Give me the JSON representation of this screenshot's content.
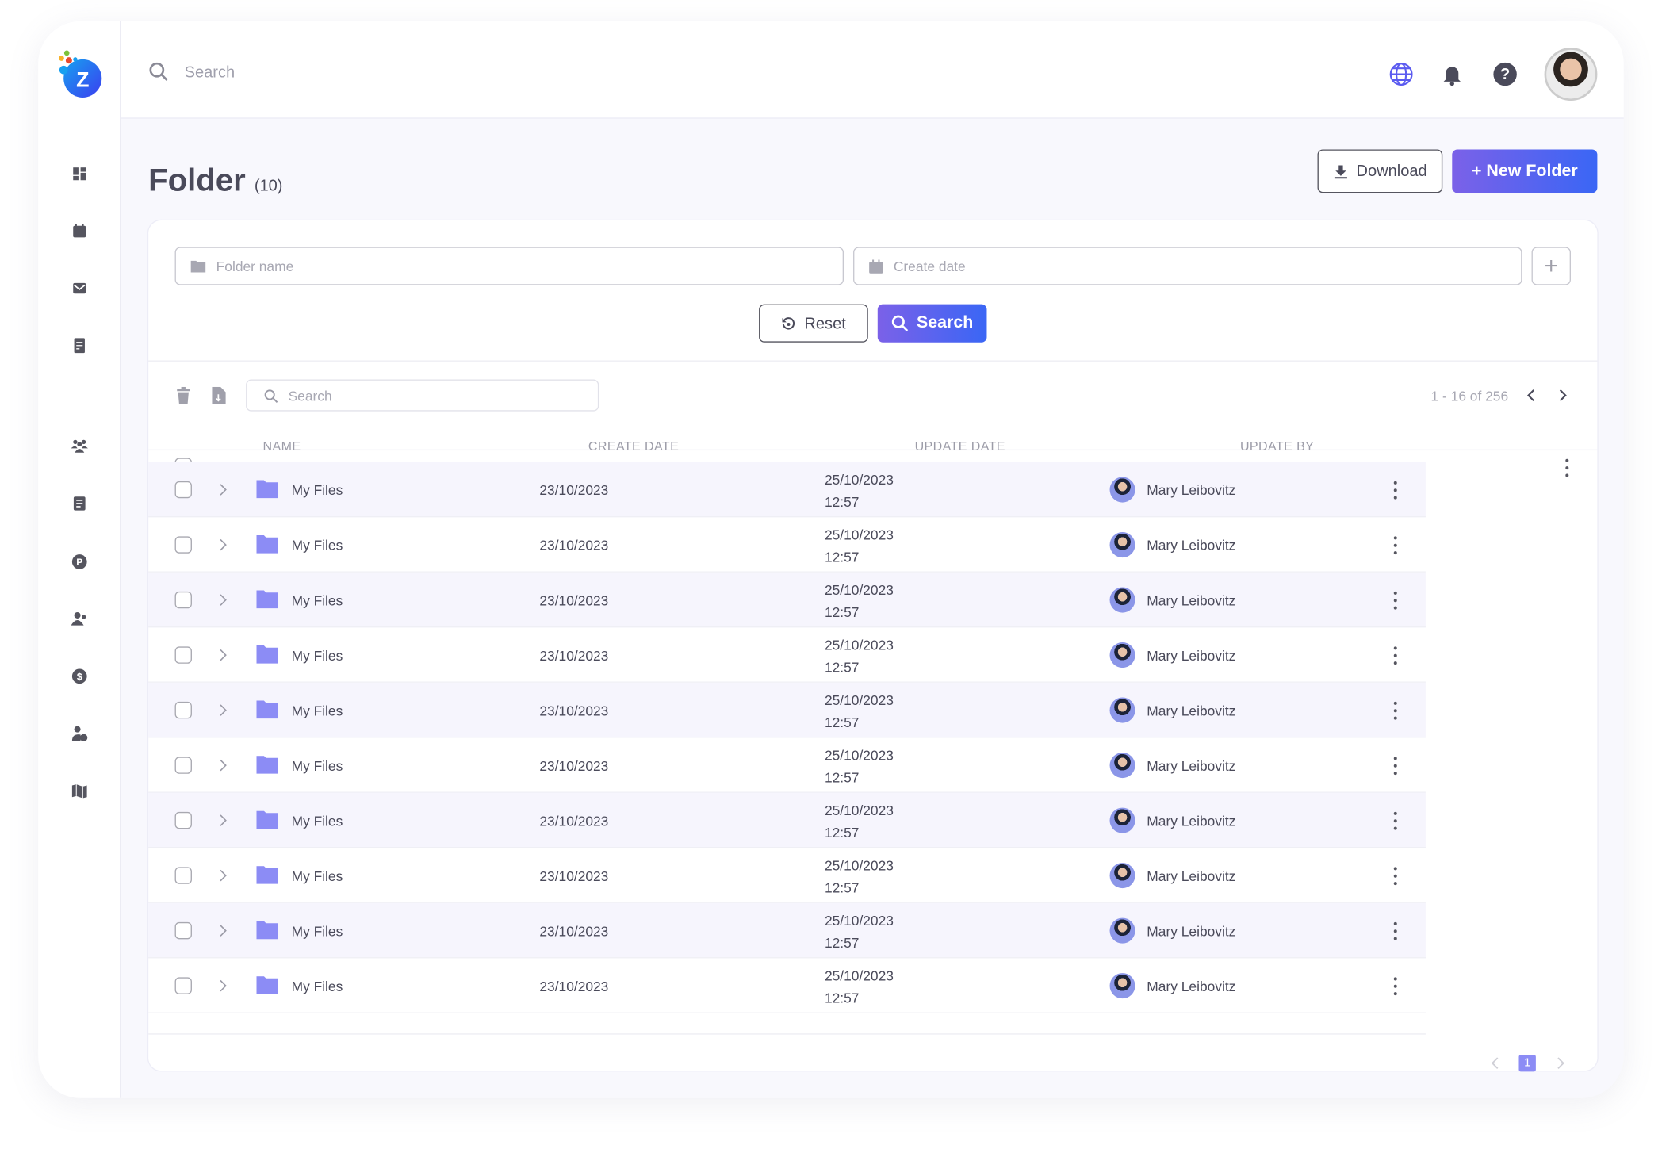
{
  "header": {
    "search_placeholder": "Search"
  },
  "page": {
    "title": "Folder",
    "count": "(10)"
  },
  "actions": {
    "download": "Download",
    "new_folder": "+ New Folder"
  },
  "filters": {
    "folder_name_placeholder": "Folder name",
    "create_date_placeholder": "Create date",
    "reset": "Reset",
    "search": "Search"
  },
  "toolbar": {
    "search_placeholder": "Search",
    "range": "1 - 16 of 256"
  },
  "columns": [
    "NAME",
    "CREATE DATE",
    "UPDATE DATE",
    "UPDATE BY"
  ],
  "rows": [
    {
      "name": "My Files",
      "create_date": "23/10/2023",
      "update_date": "25/10/2023",
      "update_time": "12:57",
      "update_by": "Mary Leibovitz"
    },
    {
      "name": "My Files",
      "create_date": "23/10/2023",
      "update_date": "25/10/2023",
      "update_time": "12:57",
      "update_by": "Mary Leibovitz"
    },
    {
      "name": "My Files",
      "create_date": "23/10/2023",
      "update_date": "25/10/2023",
      "update_time": "12:57",
      "update_by": "Mary Leibovitz"
    },
    {
      "name": "My Files",
      "create_date": "23/10/2023",
      "update_date": "25/10/2023",
      "update_time": "12:57",
      "update_by": "Mary Leibovitz"
    },
    {
      "name": "My Files",
      "create_date": "23/10/2023",
      "update_date": "25/10/2023",
      "update_time": "12:57",
      "update_by": "Mary Leibovitz"
    },
    {
      "name": "My Files",
      "create_date": "23/10/2023",
      "update_date": "25/10/2023",
      "update_time": "12:57",
      "update_by": "Mary Leibovitz"
    },
    {
      "name": "My Files",
      "create_date": "23/10/2023",
      "update_date": "25/10/2023",
      "update_time": "12:57",
      "update_by": "Mary Leibovitz"
    },
    {
      "name": "My Files",
      "create_date": "23/10/2023",
      "update_date": "25/10/2023",
      "update_time": "12:57",
      "update_by": "Mary Leibovitz"
    },
    {
      "name": "My Files",
      "create_date": "23/10/2023",
      "update_date": "25/10/2023",
      "update_time": "12:57",
      "update_by": "Mary Leibovitz"
    },
    {
      "name": "My Files",
      "create_date": "23/10/2023",
      "update_date": "25/10/2023",
      "update_time": "12:57",
      "update_by": "Mary Leibovitz"
    }
  ],
  "pagination": {
    "current": "1"
  },
  "sidebar": {
    "icons": [
      "dashboard-icon",
      "calendar-icon",
      "mail-icon",
      "checklist-icon",
      "team-icon",
      "document-icon",
      "parking-icon",
      "users-icon",
      "dollar-icon",
      "user-edit-icon",
      "map-icon"
    ]
  },
  "colors": {
    "accent_start": "#7b61e8",
    "accent_end": "#3a66f5",
    "folder": "#8c8cf5",
    "text": "#4a4a5a"
  }
}
